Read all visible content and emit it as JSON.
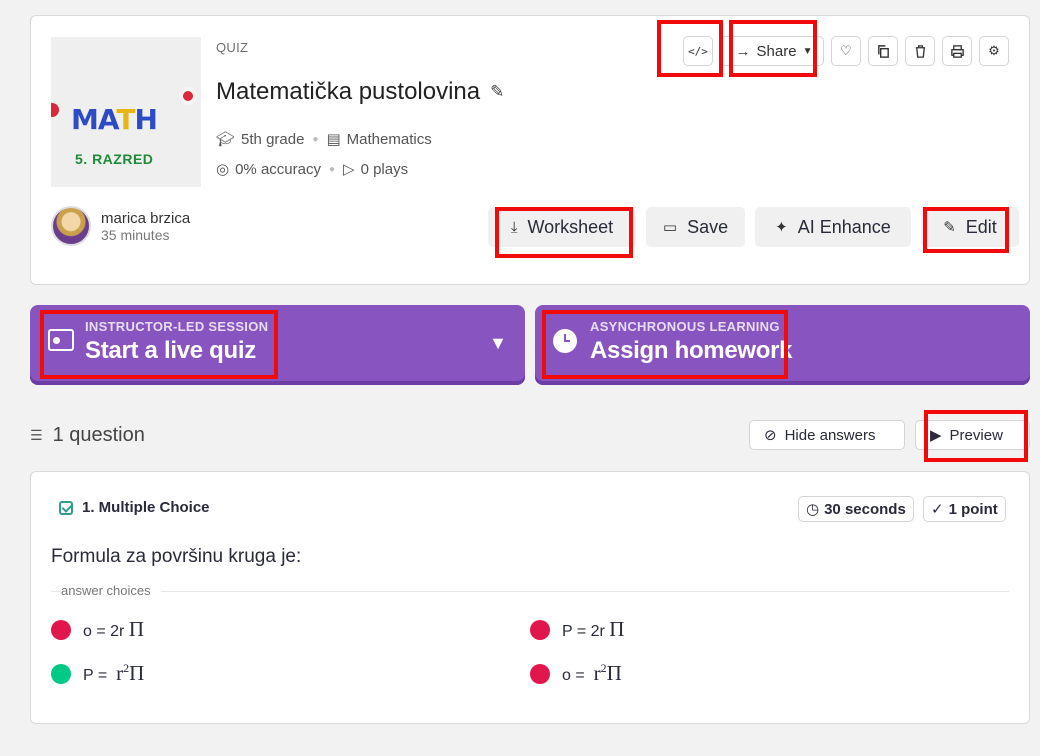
{
  "header": {
    "quiz_label": "QUIZ",
    "title": "Matematička pustolovina",
    "grade": "5th grade",
    "subject": "Mathematics",
    "accuracy": "0% accuracy",
    "plays": "0 plays",
    "thumbnail_word": "MATH",
    "thumbnail_caption": "5. RAZRED"
  },
  "toolbar": {
    "share_label": "Share",
    "icons": [
      "code-icon",
      "share-arrow-icon",
      "heart-icon",
      "copy-icon",
      "trash-icon",
      "print-icon",
      "settings-icon"
    ]
  },
  "author": {
    "name": "marica brzica",
    "time": "35 minutes"
  },
  "actions": {
    "worksheet": "Worksheet",
    "save": "Save",
    "ai_enhance": "AI Enhance",
    "edit": "Edit"
  },
  "live": {
    "sub": "INSTRUCTOR-LED SESSION",
    "main": "Start a live quiz"
  },
  "homework": {
    "sub": "ASYNCHRONOUS LEARNING",
    "main": "Assign homework"
  },
  "questions_bar": {
    "count": "1 question",
    "hide_answers": "Hide answers",
    "preview": "Preview"
  },
  "question": {
    "type": "1. Multiple Choice",
    "time": "30 seconds",
    "points": "1 point",
    "text": "Formula za površinu kruga je:",
    "choices_label": "answer choices",
    "choices": [
      {
        "lead": "o = 2r",
        "math": "Π",
        "correct": false
      },
      {
        "lead": "P = 2r",
        "math": "Π",
        "correct": false
      },
      {
        "lead": "P = ",
        "math": "r",
        "sup": "2",
        "tail": "Π",
        "correct": true
      },
      {
        "lead": "o = ",
        "math": "r",
        "sup": "2",
        "tail": "Π",
        "correct": false
      }
    ]
  },
  "colors": {
    "purple": "#8854c0",
    "wrong": "#e0164d",
    "correct": "#00c985",
    "highlight": "#f00a0a"
  }
}
